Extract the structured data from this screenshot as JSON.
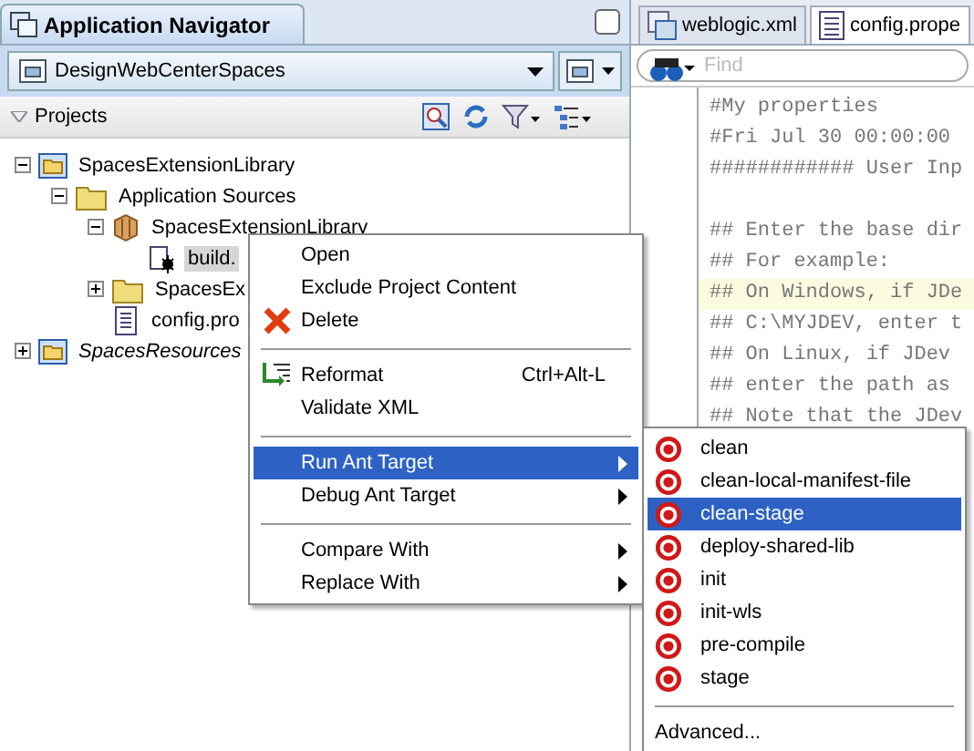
{
  "navigator": {
    "title": "Application Navigator",
    "application": "DesignWebCenterSpaces",
    "section": "Projects"
  },
  "tree": [
    {
      "label": "SpacesExtensionLibrary",
      "kind": "project",
      "italic": false,
      "selected": false,
      "expanded": true,
      "children": [
        {
          "label": "Application Sources",
          "kind": "folder",
          "italic": false,
          "selected": false,
          "expanded": true,
          "children": [
            {
              "label": "SpacesExtensionLibrary",
              "kind": "package",
              "italic": false,
              "selected": false,
              "expanded": true,
              "children": [
                {
                  "label": "build.",
                  "kind": "antfile",
                  "italic": false,
                  "selected": true
                }
              ]
            },
            {
              "label": "SpacesEx",
              "kind": "folder",
              "italic": false,
              "selected": false,
              "expanded": false
            },
            {
              "label": "config.pro",
              "kind": "textfile",
              "italic": false,
              "selected": false
            }
          ]
        }
      ]
    },
    {
      "label": "SpacesResources",
      "kind": "project",
      "italic": true,
      "selected": false,
      "expanded": false
    }
  ],
  "editor": {
    "tabs": [
      {
        "label": "weblogic.xml",
        "kind": "xml",
        "selected": false
      },
      {
        "label": "config.prope",
        "kind": "text",
        "selected": true
      }
    ],
    "find_placeholder": "Find",
    "lines": [
      {
        "text": "#My properties",
        "highlighted": false
      },
      {
        "text": "#Fri Jul 30 00:00:00",
        "highlighted": false
      },
      {
        "text": "############ User Inp",
        "highlighted": false
      },
      {
        "highlighted": false
      },
      {
        "text": "## Enter the base dir",
        "highlighted": false
      },
      {
        "text": "## For example:",
        "highlighted": false
      },
      {
        "text": "## On Windows, if JDe",
        "highlighted": true
      },
      {
        "text": "## C:\\MYJDEV, enter t",
        "highlighted": false
      },
      {
        "text": "## On Linux, if JDev",
        "highlighted": false
      },
      {
        "text": "## enter the path as",
        "highlighted": false
      },
      {
        "text": "## Note that the JDev",
        "highlighted": false
      }
    ]
  },
  "context_menu": [
    {
      "kind": "item",
      "label": "Open",
      "selected": false
    },
    {
      "kind": "item",
      "label": "Exclude Project Content",
      "selected": false
    },
    {
      "kind": "delete",
      "label": "Delete",
      "selected": false
    },
    {
      "kind": "separator"
    },
    {
      "kind": "reformat",
      "label": "Reformat",
      "shortcut": "Ctrl+Alt-L",
      "selected": false
    },
    {
      "kind": "item",
      "label": "Validate XML",
      "selected": false
    },
    {
      "kind": "separator"
    },
    {
      "kind": "submenu",
      "label": "Run Ant Target",
      "selected": true
    },
    {
      "kind": "submenu",
      "label": "Debug Ant Target",
      "selected": false
    },
    {
      "kind": "separator"
    },
    {
      "kind": "submenu",
      "label": "Compare With",
      "selected": false
    },
    {
      "kind": "submenu",
      "label": "Replace With",
      "selected": false
    }
  ],
  "submenu": [
    {
      "kind": "target",
      "label": "clean",
      "selected": false
    },
    {
      "kind": "target",
      "label": "clean-local-manifest-file",
      "selected": false
    },
    {
      "kind": "target",
      "label": "clean-stage",
      "selected": true
    },
    {
      "kind": "target",
      "label": "deploy-shared-lib",
      "selected": false
    },
    {
      "kind": "target",
      "label": "init",
      "selected": false
    },
    {
      "kind": "target",
      "label": "init-wls",
      "selected": false
    },
    {
      "kind": "target",
      "label": "pre-compile",
      "selected": false
    },
    {
      "kind": "target",
      "label": "stage",
      "selected": false
    },
    {
      "kind": "separator"
    },
    {
      "kind": "item",
      "label": "Advanced...",
      "selected": false
    }
  ]
}
